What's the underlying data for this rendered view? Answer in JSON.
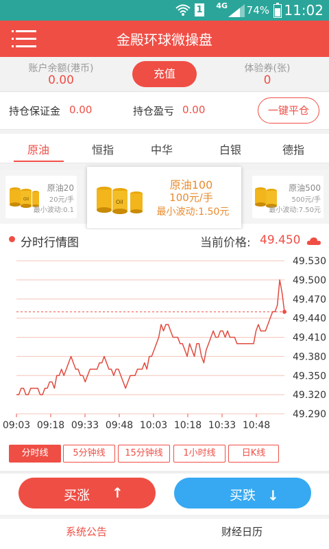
{
  "status_bar": {
    "time": "11:02",
    "battery": "74%",
    "network": "4G",
    "sim": "1"
  },
  "header": {
    "title": "金殿环球微操盘"
  },
  "account": {
    "balance_label": "账户余额(港币)",
    "balance_value": "0.00",
    "recharge_label": "充值",
    "voucher_label": "体验券(张)",
    "voucher_value": "0"
  },
  "positions": {
    "margin_label": "持仓保证金",
    "margin_value": "0.00",
    "pnl_label": "持仓盈亏",
    "pnl_value": "0.00",
    "close_all_label": "一键平仓"
  },
  "tabs": [
    "原油",
    "恒指",
    "中华",
    "白银",
    "德指"
  ],
  "active_tab": 0,
  "products": {
    "left": {
      "name": "原油20",
      "price": "20元/手",
      "tick": "最小波动:0.1"
    },
    "active": {
      "name": "原油100",
      "price": "100元/手",
      "tick": "最小波动:1.50元"
    },
    "right": {
      "name": "原油500",
      "price": "500元/手",
      "tick": "最小波动:7.50元"
    }
  },
  "chart_header": {
    "title": "分时行情图",
    "price_label": "当前价格:",
    "price_value": "49.450"
  },
  "chart_data": {
    "type": "line",
    "title": "分时行情图",
    "x_ticks": [
      "09:03",
      "09:18",
      "09:33",
      "09:48",
      "10:03",
      "10:18",
      "10:33",
      "10:48"
    ],
    "y_ticks": [
      "49.530",
      "49.500",
      "49.470",
      "49.440",
      "49.410",
      "49.380",
      "49.350",
      "49.320",
      "49.290"
    ],
    "ylim": [
      49.29,
      49.53
    ],
    "reference_line": 49.45,
    "grid": true,
    "series": [
      {
        "values": [
          49.32,
          49.32,
          49.33,
          49.33,
          49.32,
          49.32,
          49.33,
          49.33,
          49.33,
          49.33,
          49.32,
          49.32,
          49.33,
          49.33,
          49.34,
          49.34,
          49.33,
          49.35,
          49.35,
          49.36,
          49.35,
          49.36,
          49.37,
          49.38,
          49.37,
          49.36,
          49.36,
          49.35,
          49.35,
          49.34,
          49.35,
          49.36,
          49.36,
          49.36,
          49.36,
          49.37,
          49.37,
          49.38,
          49.37,
          49.36,
          49.36,
          49.35,
          49.36,
          49.36,
          49.35,
          49.34,
          49.33,
          49.34,
          49.35,
          49.35,
          49.35,
          49.36,
          49.36,
          49.36,
          49.37,
          49.36,
          49.38,
          49.38,
          49.39,
          49.4,
          49.41,
          49.43,
          49.42,
          49.43,
          49.43,
          49.42,
          49.41,
          49.41,
          49.41,
          49.4,
          49.4,
          49.39,
          49.38,
          49.4,
          49.39,
          49.38,
          49.4,
          49.4,
          49.38,
          49.37,
          49.39,
          49.4,
          49.41,
          49.42,
          49.41,
          49.41,
          49.42,
          49.42,
          49.41,
          49.42,
          49.41,
          49.41,
          49.41,
          49.4,
          49.4,
          49.4,
          49.4,
          49.4,
          49.4,
          49.4,
          49.4,
          49.42,
          49.43,
          49.42,
          49.42,
          49.42,
          49.43,
          49.44,
          49.45,
          49.45,
          49.46,
          49.5,
          49.48,
          49.45
        ]
      }
    ]
  },
  "periods": [
    "分时线",
    "5分钟线",
    "15分钟线",
    "1小时线",
    "日K线"
  ],
  "active_period": 0,
  "trade": {
    "buy_up": "买涨",
    "buy_down": "买跌"
  },
  "bottom_tabs": [
    "系统公告",
    "财经日历"
  ],
  "colors": {
    "accent": "#ef4e45",
    "blue": "#36a9f2",
    "status_bar": "#2ba59a",
    "product_orange": "#e98b2f"
  }
}
